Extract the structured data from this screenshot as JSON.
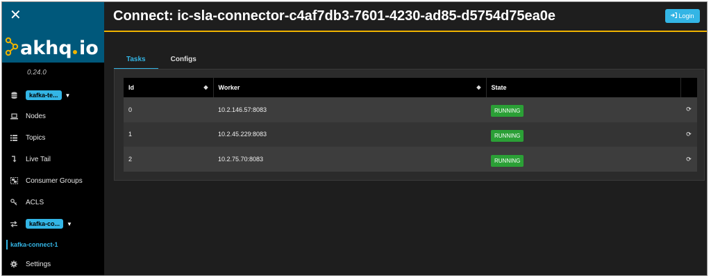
{
  "app": {
    "version": "0.24.0"
  },
  "sidebar": {
    "cluster_label": "kafka-te...",
    "items": [
      {
        "label": "Nodes",
        "icon": "laptop-icon"
      },
      {
        "label": "Topics",
        "icon": "list-icon"
      },
      {
        "label": "Live Tail",
        "icon": "level-down-icon"
      },
      {
        "label": "Consumer Groups",
        "icon": "object-group-icon"
      },
      {
        "label": "ACLS",
        "icon": "key-icon"
      }
    ],
    "connect_label": "kafka-co...",
    "connect_sub_item": "kafka-connect-1",
    "settings_label": "Settings"
  },
  "header": {
    "title": "Connect: ic-sla-connector-c4af7db3-7601-4230-ad85-d5754d75ea0e",
    "login_label": "Login"
  },
  "tabs": [
    {
      "label": "Tasks",
      "active": true
    },
    {
      "label": "Configs",
      "active": false
    }
  ],
  "table": {
    "columns": [
      "Id",
      "Worker",
      "State"
    ],
    "rows": [
      {
        "id": "0",
        "worker": "10.2.146.57:8083",
        "state": "RUNNING"
      },
      {
        "id": "1",
        "worker": "10.2.45.229:8083",
        "state": "RUNNING"
      },
      {
        "id": "2",
        "worker": "10.2.75.70:8083",
        "state": "RUNNING"
      }
    ]
  },
  "colors": {
    "accent": "#33b5e5",
    "header_line": "#f0b400",
    "running": "#2ba036",
    "logo_bg": "#00587b"
  }
}
